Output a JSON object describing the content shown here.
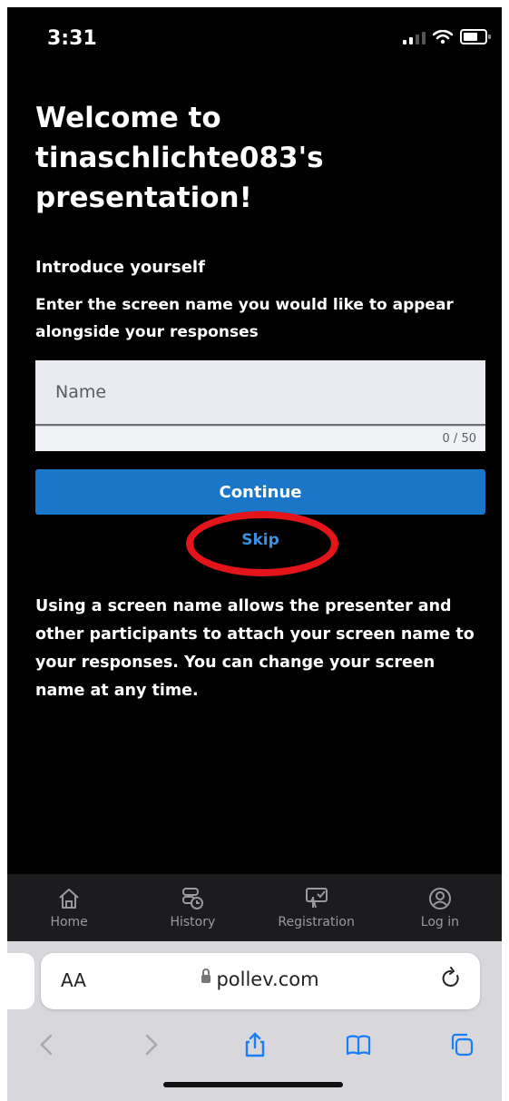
{
  "status_bar": {
    "time": "3:31"
  },
  "page": {
    "title": "Welcome to tinaschlichte083's presentation!",
    "subheading": "Introduce yourself",
    "instructions": "Enter the screen name you would like to appear alongside your responses",
    "name_input": {
      "placeholder": "Name",
      "value": ""
    },
    "char_counter": "0 / 50",
    "continue_label": "Continue",
    "skip_label": "Skip",
    "info_text": "Using a screen name allows the presenter and other participants to attach your screen name to your responses. You can change your screen name at any time."
  },
  "bottom_nav": {
    "items": [
      {
        "label": "Home",
        "icon": "home-icon"
      },
      {
        "label": "History",
        "icon": "history-icon"
      },
      {
        "label": "Registration",
        "icon": "registration-icon"
      },
      {
        "label": "Log in",
        "icon": "user-icon"
      }
    ]
  },
  "browser": {
    "text_size_label": "AA",
    "url": "pollev.com"
  },
  "colors": {
    "background": "#000000",
    "accent": "#1a76c7",
    "skip_link": "#3d8fe0",
    "highlight_circle": "#e3141a"
  }
}
